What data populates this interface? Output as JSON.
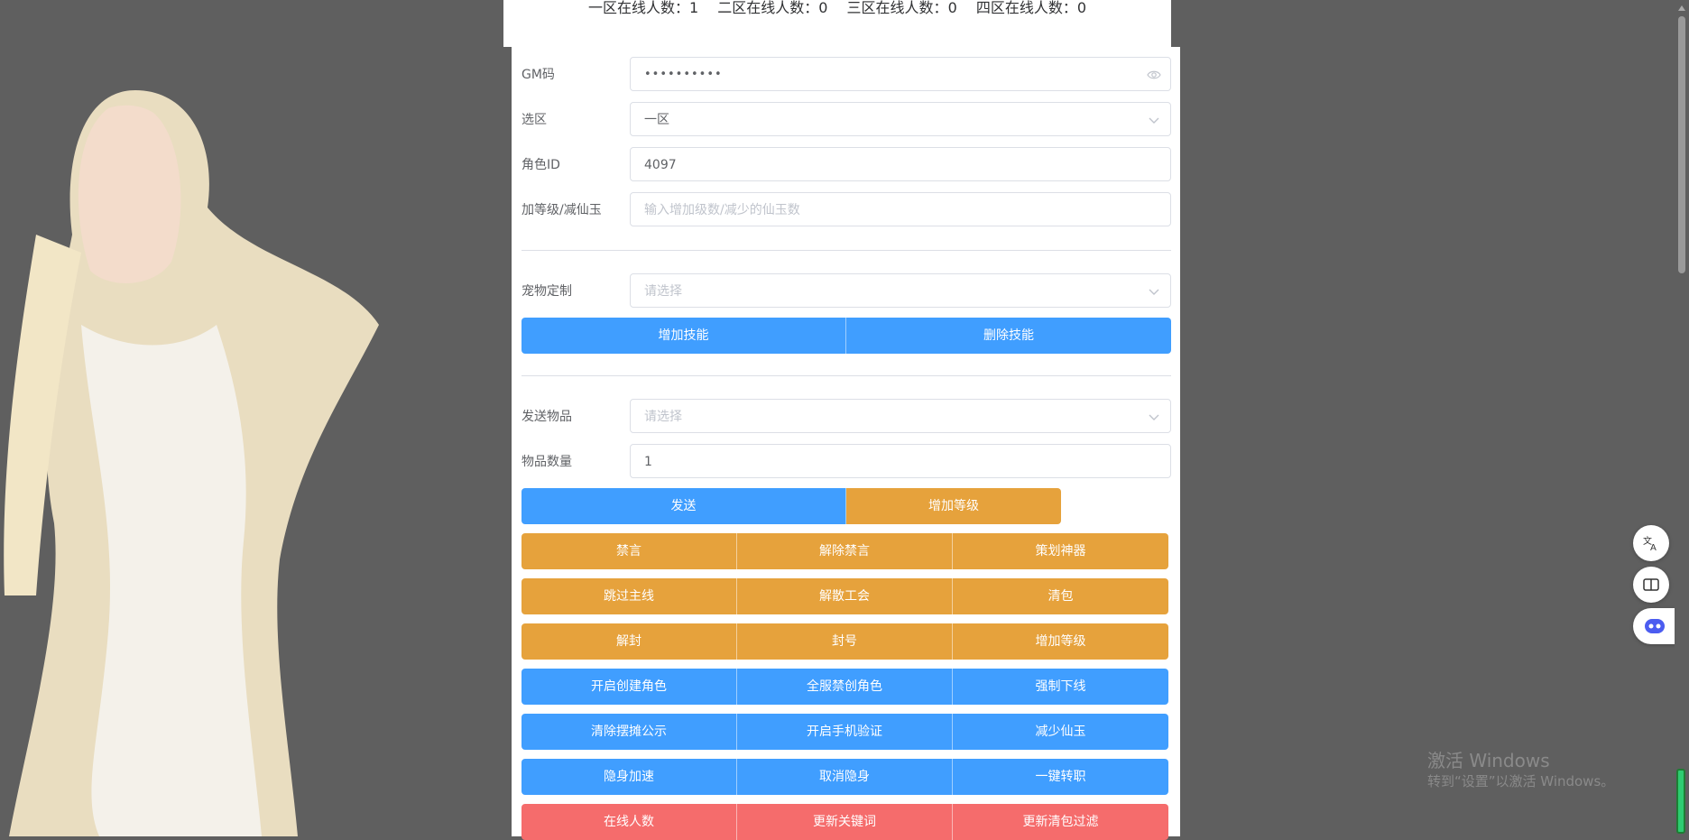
{
  "online_stats": [
    {
      "label": "一区在线人数：",
      "value": "1"
    },
    {
      "label": "二区在线人数：",
      "value": "0"
    },
    {
      "label": "三区在线人数：",
      "value": "0"
    },
    {
      "label": "四区在线人数：",
      "value": "0"
    }
  ],
  "form": {
    "gm_code": {
      "label": "GM码",
      "value": "••••••••••"
    },
    "zone": {
      "label": "选区",
      "value": "一区"
    },
    "role_id": {
      "label": "角色ID",
      "value": "4097"
    },
    "level": {
      "label": "加等级/减仙玉",
      "placeholder": "输入增加级数/减少的仙玉数"
    },
    "pet": {
      "label": "宠物定制",
      "placeholder": "请选择"
    },
    "item": {
      "label": "发送物品",
      "placeholder": "请选择"
    },
    "qty": {
      "label": "物品数量",
      "value": "1"
    }
  },
  "buttons": {
    "add_skill": "增加技能",
    "del_skill": "删除技能",
    "send": "发送",
    "add_level_1": "增加等级",
    "row1": [
      "禁言",
      "解除禁言",
      "策划神器"
    ],
    "row2": [
      "跳过主线",
      "解散工会",
      "清包"
    ],
    "row3": [
      "解封",
      "封号",
      "增加等级"
    ],
    "row4": [
      "开启创建角色",
      "全服禁创角色",
      "强制下线"
    ],
    "row5": [
      "清除摆摊公示",
      "开启手机验证",
      "减少仙玉"
    ],
    "row6": [
      "隐身加速",
      "取消隐身",
      "一键转职"
    ],
    "row7": [
      "在线人数",
      "更新关键词",
      "更新清包过滤"
    ]
  },
  "watermark": {
    "line1": "激活 Windows",
    "line2": "转到“设置”以激活 Windows。"
  },
  "icons": {
    "eye": "eye-icon",
    "chevron": "chevron-down-icon",
    "translate": "translate-icon",
    "reader": "reader-icon",
    "ai": "ai-assistant-icon"
  },
  "colors": {
    "primary": "#409eff",
    "warning": "#e6a23c",
    "danger": "#f56c6c"
  }
}
